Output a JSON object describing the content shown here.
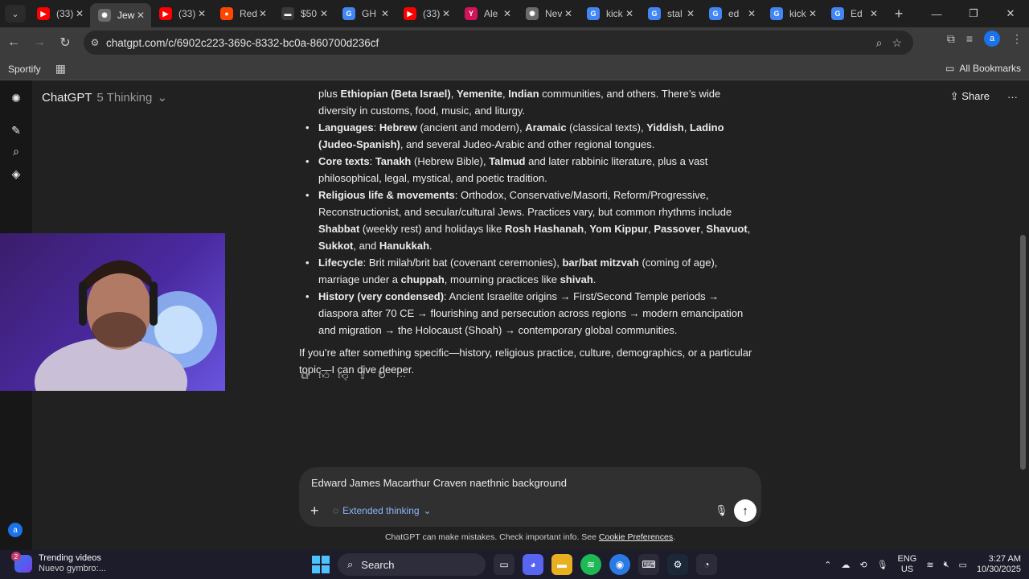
{
  "browser": {
    "tabs": [
      {
        "title": "(33)",
        "fav_color": "#ff0000",
        "fav_glyph": "▶"
      },
      {
        "title": "Jew",
        "fav_color": "#6b6b6b",
        "fav_glyph": "✺",
        "active": true
      },
      {
        "title": "(33)",
        "fav_color": "#ff0000",
        "fav_glyph": "▶"
      },
      {
        "title": "Red",
        "fav_color": "#ff4500",
        "fav_glyph": "●"
      },
      {
        "title": "$50",
        "fav_color": "#ffffff",
        "fav_glyph": "▬"
      },
      {
        "title": "GH",
        "fav_color": "#4285f4",
        "fav_glyph": "G"
      },
      {
        "title": "(33)",
        "fav_color": "#ff0000",
        "fav_glyph": "▶"
      },
      {
        "title": "Ale",
        "fav_color": "#d4145a",
        "fav_glyph": "Y"
      },
      {
        "title": "Nev",
        "fav_color": "#6b6b6b",
        "fav_glyph": "✺"
      },
      {
        "title": "kick",
        "fav_color": "#4285f4",
        "fav_glyph": "G"
      },
      {
        "title": "stal",
        "fav_color": "#4285f4",
        "fav_glyph": "G"
      },
      {
        "title": "ed",
        "fav_color": "#4285f4",
        "fav_glyph": "G"
      },
      {
        "title": "kick",
        "fav_color": "#4285f4",
        "fav_glyph": "G"
      },
      {
        "title": "Ed",
        "fav_color": "#4285f4",
        "fav_glyph": "G"
      }
    ],
    "url": "chatgpt.com/c/6902c223-369c-8332-bc0a-860700d236cf",
    "bookmarks": {
      "spotify": "Sportify",
      "all": "All Bookmarks"
    },
    "profile_initial": "a"
  },
  "app": {
    "model_name": "ChatGPT",
    "model_variant": "5 Thinking",
    "share_label": "Share",
    "avatar_initial": "a"
  },
  "message": {
    "partial_line": {
      "pre": "plus ",
      "b1": "Ethiopian (Beta Israel)",
      "s1": ", ",
      "b2": "Yemenite",
      "s2": ", ",
      "b3": "Indian",
      "post": " communities, and others. There’s wide diversity in customs, food, music, and liturgy."
    },
    "bullets": [
      {
        "label": "Languages",
        "parts": [
          {
            "t": ": "
          },
          {
            "b": "Hebrew"
          },
          {
            "t": " (ancient and modern), "
          },
          {
            "b": "Aramaic"
          },
          {
            "t": " (classical texts), "
          },
          {
            "b": "Yiddish"
          },
          {
            "t": ", "
          },
          {
            "b": "Ladino (Judeo-Spanish)"
          },
          {
            "t": ", and several Judeo-Arabic and other regional tongues."
          }
        ]
      },
      {
        "label": "Core texts",
        "parts": [
          {
            "t": ": "
          },
          {
            "b": "Tanakh"
          },
          {
            "t": " (Hebrew Bible), "
          },
          {
            "b": "Talmud"
          },
          {
            "t": " and later rabbinic literature, plus a vast philosophical, legal, mystical, and poetic tradition."
          }
        ]
      },
      {
        "label": "Religious life & movements",
        "parts": [
          {
            "t": ": Orthodox, Conservative/Masorti, Reform/Progressive, Reconstructionist, and secular/cultural Jews. Practices vary, but common rhythms include "
          },
          {
            "b": "Shabbat"
          },
          {
            "t": " (weekly rest) and holidays like "
          },
          {
            "b": "Rosh Hashanah"
          },
          {
            "t": ", "
          },
          {
            "b": "Yom Kippur"
          },
          {
            "t": ", "
          },
          {
            "b": "Passover"
          },
          {
            "t": ", "
          },
          {
            "b": "Shavuot"
          },
          {
            "t": ", "
          },
          {
            "b": "Sukkot"
          },
          {
            "t": ", and "
          },
          {
            "b": "Hanukkah"
          },
          {
            "t": "."
          }
        ]
      },
      {
        "label": "Lifecycle",
        "parts": [
          {
            "t": ": Brit milah/brit bat (covenant ceremonies), "
          },
          {
            "b": "bar/bat mitzvah"
          },
          {
            "t": " (coming of age), marriage under a "
          },
          {
            "b": "chuppah"
          },
          {
            "t": ", mourning practices like "
          },
          {
            "b": "shivah"
          },
          {
            "t": "."
          }
        ]
      },
      {
        "label": "History (very condensed)",
        "parts": [
          {
            "t": ": Ancient Israelite origins → First/Second Temple periods → diaspora after 70 CE → flourishing and persecution across regions → modern emancipation and migration → the Holocaust (Shoah) → contemporary global communities."
          }
        ]
      }
    ],
    "followup": "If you’re after something specific—history, religious practice, culture, demographics, or a particular topic—I can dive deeper."
  },
  "composer": {
    "text": "Edward James Macarthur Craven naethnic background",
    "mode_label": "Extended thinking"
  },
  "disclaimer": {
    "text": "ChatGPT can make mistakes. Check important info. See ",
    "link": "Cookie Preferences",
    "end": "."
  },
  "taskbar": {
    "widget_title": "Trending videos",
    "widget_sub": "Nuevo gymbro:...",
    "widget_badge": "2",
    "search_label": "Search",
    "lang_line1": "ENG",
    "lang_line2": "US",
    "time": "3:27 AM",
    "date": "10/30/2025"
  }
}
